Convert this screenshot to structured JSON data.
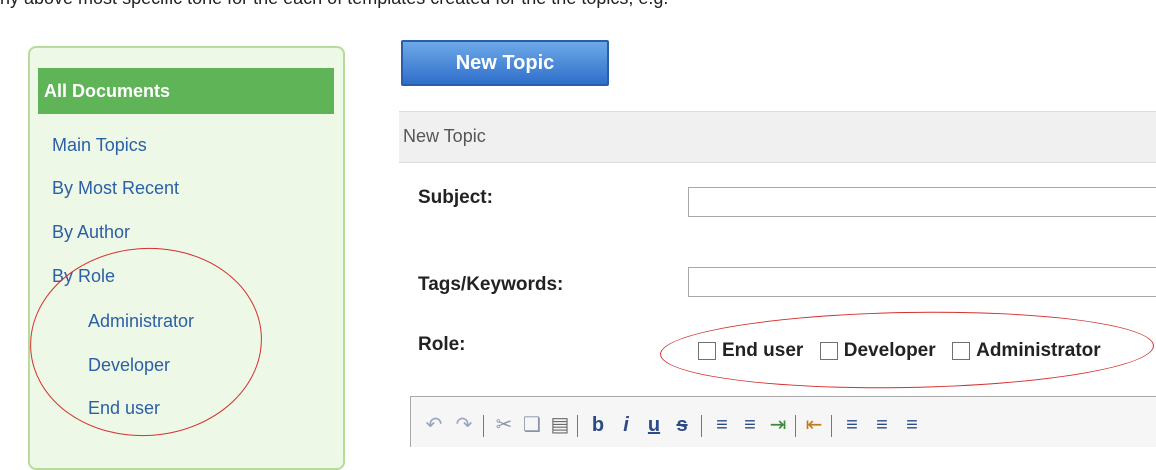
{
  "cut_text": "ny above most specific tone for the each of templates created for the the topics, e.g.",
  "sidebar": {
    "header": "All Documents",
    "items": [
      {
        "label": "Main Topics"
      },
      {
        "label": "By Most Recent"
      },
      {
        "label": "By Author"
      },
      {
        "label": "By Role"
      }
    ],
    "sub_items": [
      {
        "label": "Administrator"
      },
      {
        "label": "Developer"
      },
      {
        "label": "End user"
      }
    ]
  },
  "new_topic_button": "New Topic",
  "panel_title": "New Topic",
  "form": {
    "subject_label": "Subject:",
    "subject_value": "",
    "tags_label": "Tags/Keywords:",
    "tags_value": "",
    "role_label": "Role:",
    "role_options": [
      {
        "label": "End user",
        "checked": false
      },
      {
        "label": "Developer",
        "checked": false
      },
      {
        "label": "Administrator",
        "checked": false
      }
    ]
  },
  "toolbar_icons": [
    "undo-icon",
    "redo-icon",
    "cut-icon",
    "copy-icon",
    "paste-icon",
    "bold-icon",
    "italic-icon",
    "underline-icon",
    "strikethrough-icon",
    "numbered-list-icon",
    "bullet-list-icon",
    "indent-icon",
    "outdent-icon",
    "align-left-icon",
    "align-right-icon",
    "align-center-icon"
  ],
  "colors": {
    "sidebar_bg": "#eef8e6",
    "sidebar_header": "#5fb457",
    "link": "#2b5fa6",
    "button": "#2f6fca",
    "annotation": "#d43030"
  }
}
